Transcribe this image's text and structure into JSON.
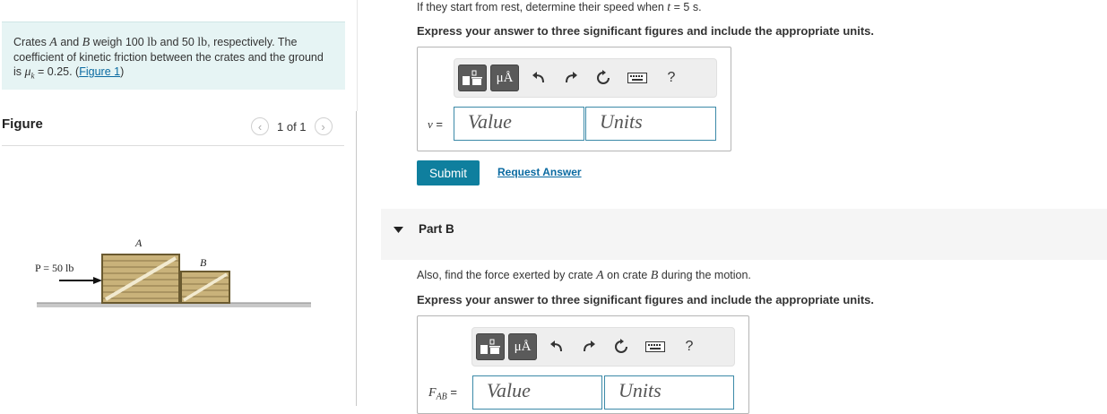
{
  "problem": {
    "text_1": "Crates ",
    "crate_a": "A",
    "text_2": " and ",
    "crate_b": "B",
    "text_3": " weigh 100 ",
    "unit_1": "lb",
    "text_4": " and 50 ",
    "unit_2": "lb",
    "text_5": ", respectively. The coefficient of kinetic friction between the crates and the ground is ",
    "mu": "μ",
    "mu_sub": "k",
    "text_6": " = 0.25. (",
    "figure_link": "Figure 1",
    "text_7": ")"
  },
  "figure": {
    "title": "Figure",
    "pager": "1 of 1",
    "prev_glyph": "‹",
    "next_glyph": "›",
    "force_label": "P = 50 lb",
    "label_a": "A",
    "label_b": "B"
  },
  "part_a": {
    "question_prefix": "If they start from rest, determine their speed when ",
    "t_var": "t",
    "question_suffix": " = 5 s.",
    "instructions": "Express your answer to three significant figures and include the appropriate units.",
    "var_label": "v",
    "equals": " =",
    "value_placeholder": "Value",
    "units_placeholder": "Units",
    "submit_label": "Submit",
    "request_label": "Request Answer"
  },
  "part_b": {
    "title": "Part B",
    "question_prefix": "Also, find the force exerted by crate ",
    "crate_a": "A",
    "question_mid": " on crate ",
    "crate_b": "B",
    "question_suffix": " during the motion.",
    "instructions": "Express your answer to three significant figures and include the appropriate units.",
    "var_label": "F",
    "var_sub": "AB",
    "equals": " =",
    "value_placeholder": "Value",
    "units_placeholder": "Units"
  },
  "toolbar": {
    "mu_a_label": "μÅ",
    "help_label": "?"
  }
}
